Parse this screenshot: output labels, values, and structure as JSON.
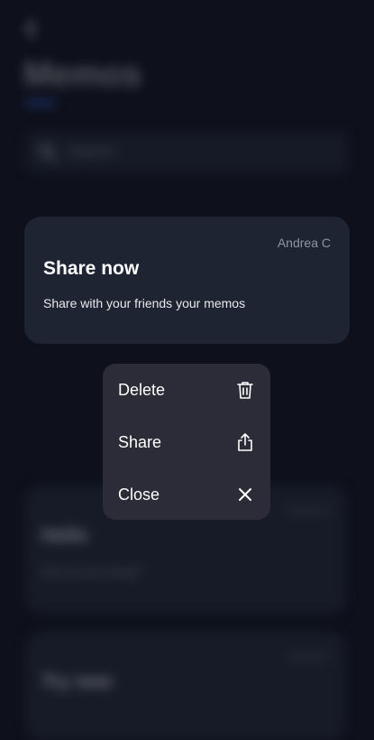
{
  "background": {
    "title": "Memos",
    "search_placeholder": "Search",
    "cards": [
      {
        "author": "Andrea C",
        "title": "Hello",
        "text": "How do you doing?"
      },
      {
        "author": "Andrea C",
        "title": "Try new"
      }
    ]
  },
  "focused_card": {
    "author": "Andrea C",
    "title": "Share now",
    "text": "Share with your friends your memos"
  },
  "context_menu": {
    "items": [
      {
        "label": "Delete",
        "icon": "trash-icon"
      },
      {
        "label": "Share",
        "icon": "share-icon"
      },
      {
        "label": "Close",
        "icon": "close-icon"
      }
    ]
  },
  "colors": {
    "background": "#0e111b",
    "card": "#1f2433",
    "menu": "#2b2c37",
    "accent": "#2d54c9"
  }
}
